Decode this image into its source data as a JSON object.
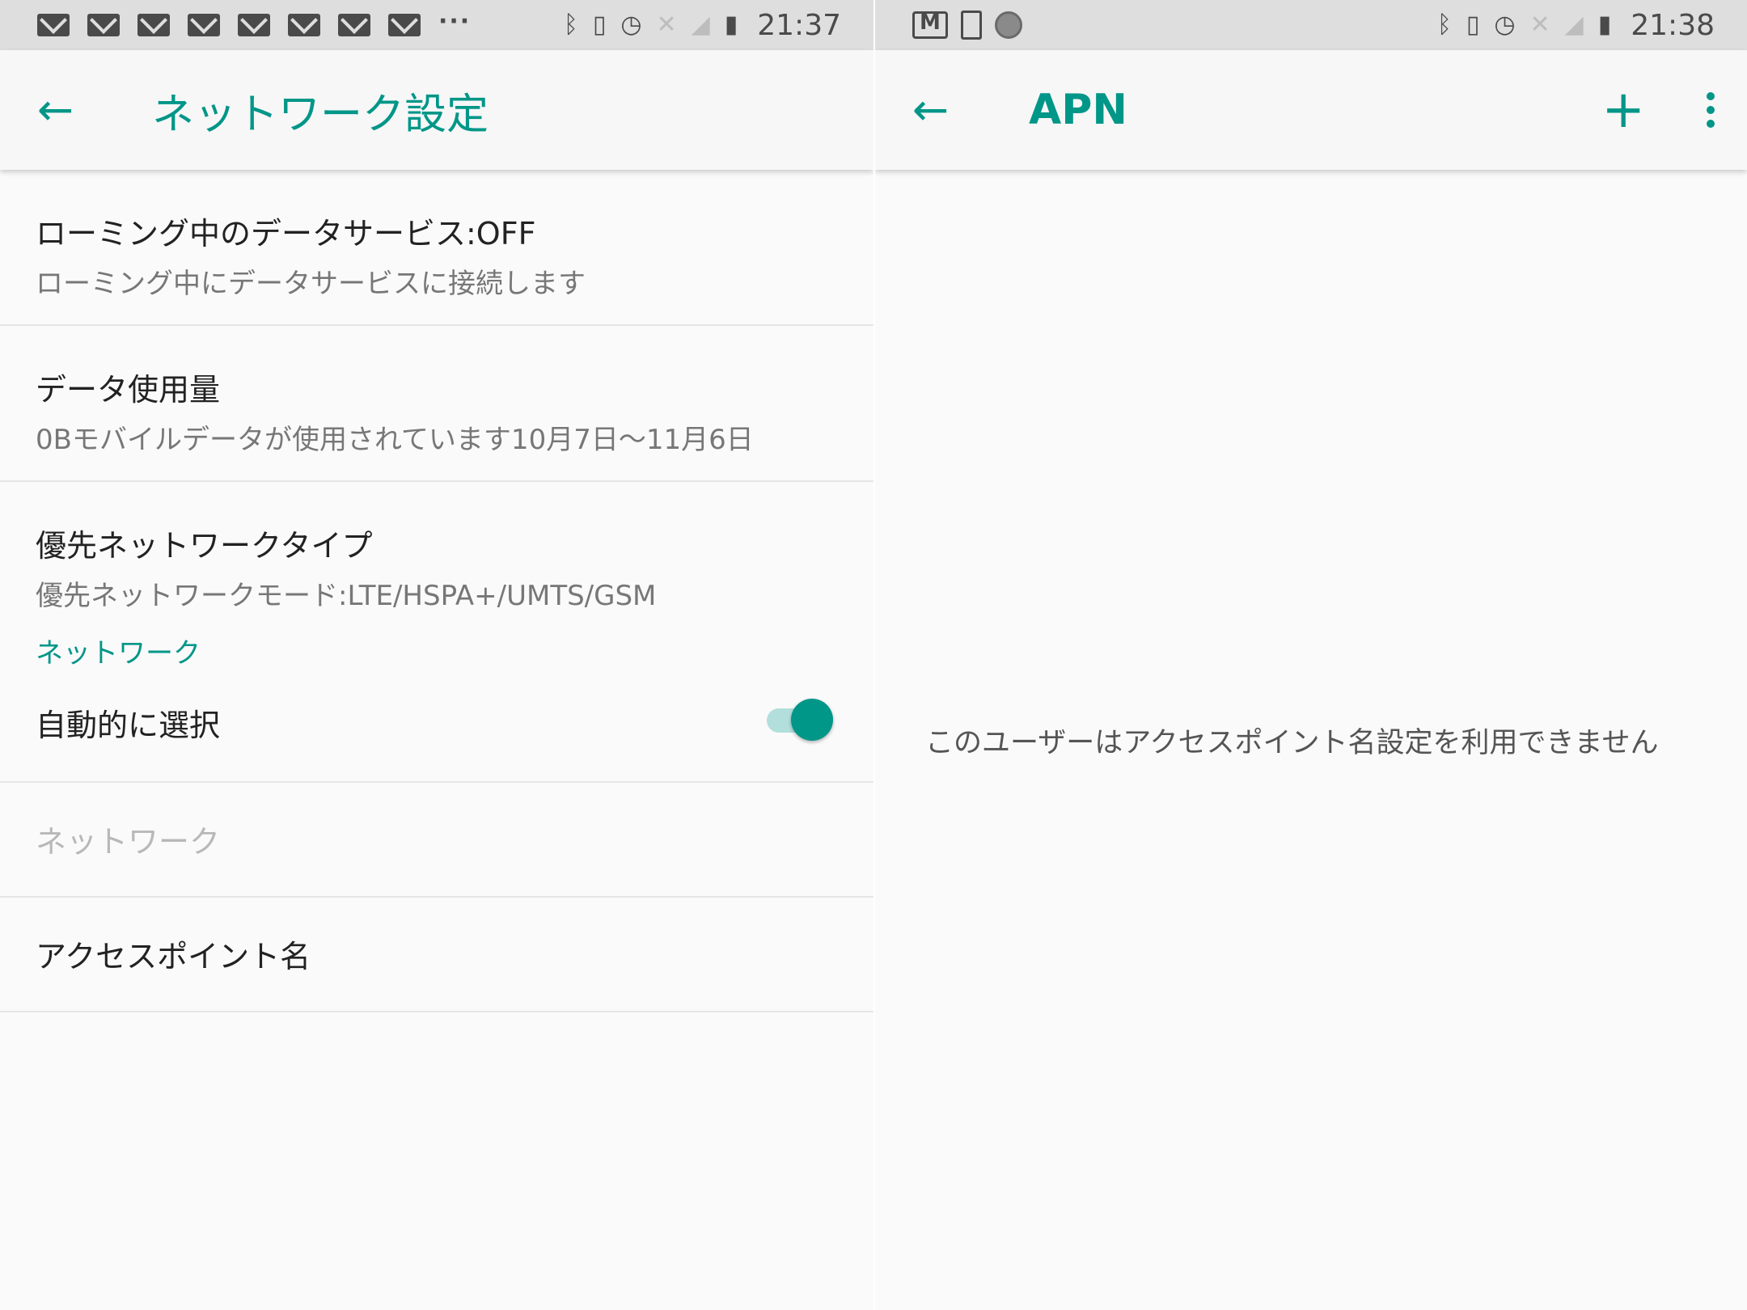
{
  "left": {
    "status": {
      "time": "21:37",
      "overflow": "···"
    },
    "appbar": {
      "title": "ネットワーク設定"
    },
    "items": [
      {
        "title": "ローミング中のデータサービス:OFF",
        "subtitle": "ローミング中にデータサービスに接続します"
      },
      {
        "title": "データ使用量",
        "subtitle": "0Bモバイルデータが使用されています10月7日〜11月6日"
      },
      {
        "title": "優先ネットワークタイプ",
        "subtitle": "優先ネットワークモード:LTE/HSPA+/UMTS/GSM"
      }
    ],
    "category": "ネットワーク",
    "auto_select": {
      "label": "自動的に選択",
      "enabled": true
    },
    "network_item": "ネットワーク",
    "apn_item": "アクセスポイント名"
  },
  "right": {
    "status": {
      "time": "21:38"
    },
    "appbar": {
      "title": "APN"
    },
    "message": "このユーザーはアクセスポイント名設定を利用できません"
  },
  "colors": {
    "accent": "#009688",
    "accent_light": "#b2dfdb",
    "statusbar": "#dedede",
    "background": "#fafafa"
  },
  "icons": [
    "mail-icon",
    "bluetooth-icon",
    "vibrate-icon",
    "alarm-icon",
    "no-sim-icon",
    "signal-icon",
    "battery-charging-icon",
    "gmail-icon",
    "clipboard-icon",
    "disc-icon",
    "back-arrow-icon",
    "add-icon",
    "more-vert-icon"
  ]
}
